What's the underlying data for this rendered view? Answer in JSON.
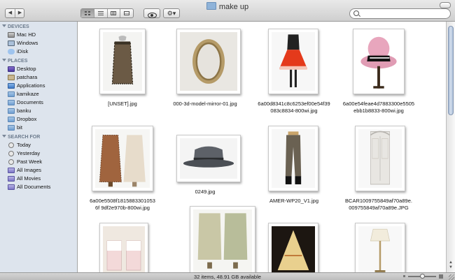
{
  "window": {
    "title": "make up"
  },
  "toolbar": {
    "back_icon": "back-arrow-icon",
    "forward_icon": "forward-arrow-icon",
    "view_modes": [
      "icon-view",
      "list-view",
      "column-view",
      "coverflow-view"
    ],
    "active_view": 0,
    "action_label": "⚙▾",
    "search": {
      "value": "",
      "placeholder": ""
    }
  },
  "sidebar": {
    "sections": [
      {
        "title": "DEVICES",
        "items": [
          {
            "label": "Mac HD",
            "icon": "disk"
          },
          {
            "label": "Windows",
            "icon": "win"
          },
          {
            "label": "iDisk",
            "icon": "cloud"
          }
        ]
      },
      {
        "title": "PLACES",
        "items": [
          {
            "label": "Desktop",
            "icon": "desk"
          },
          {
            "label": "patchara",
            "icon": "home"
          },
          {
            "label": "Applications",
            "icon": "apps"
          },
          {
            "label": "kamikaze",
            "icon": "folder"
          },
          {
            "label": "Documents",
            "icon": "folder"
          },
          {
            "label": "banku",
            "icon": "folder"
          },
          {
            "label": "Dropbox",
            "icon": "folder"
          },
          {
            "label": "bit",
            "icon": "folder"
          }
        ]
      },
      {
        "title": "SEARCH FOR",
        "items": [
          {
            "label": "Today",
            "icon": "clock"
          },
          {
            "label": "Yesterday",
            "icon": "clock"
          },
          {
            "label": "Past Week",
            "icon": "clock"
          },
          {
            "label": "All Images",
            "icon": "smart"
          },
          {
            "label": "All Movies",
            "icon": "smart"
          },
          {
            "label": "All Documents",
            "icon": "smart"
          }
        ]
      }
    ]
  },
  "files": [
    {
      "name": "[UNSET].jpg",
      "pic": "skirt"
    },
    {
      "name": "000-3d-model-mirror-01.jpg",
      "pic": "mirror"
    },
    {
      "name": "6a00d8341c8c6253ef00e54f39 083c8834-800wi.jpg",
      "pic": "dress"
    },
    {
      "name": "6a00e54feae4d7883300e5505 ebb1b8833-800wi.jpg",
      "pic": "hat"
    },
    {
      "name": "6a00e5508f1815883301053 6f 9df2e970b-800wi.jpg",
      "pic": "coats"
    },
    {
      "name": "0249.jpg",
      "pic": "fedora"
    },
    {
      "name": "AMER-WP20_V1.jpg",
      "pic": "pants"
    },
    {
      "name": "BCAR1009755849af70a89e. 009755849af70a89e.JPG",
      "pic": "wardrobe"
    },
    {
      "name": "",
      "pic": "chairs"
    },
    {
      "name": "",
      "pic": "robes"
    },
    {
      "name": "",
      "pic": "cape"
    },
    {
      "name": "",
      "pic": "lamp"
    }
  ],
  "status": {
    "text": "32 items, 48.91 GB available",
    "zoom_level": 0.5
  },
  "colors": {
    "sidebar_bg": "#dde4ed",
    "selection": "#8fb3d9"
  }
}
